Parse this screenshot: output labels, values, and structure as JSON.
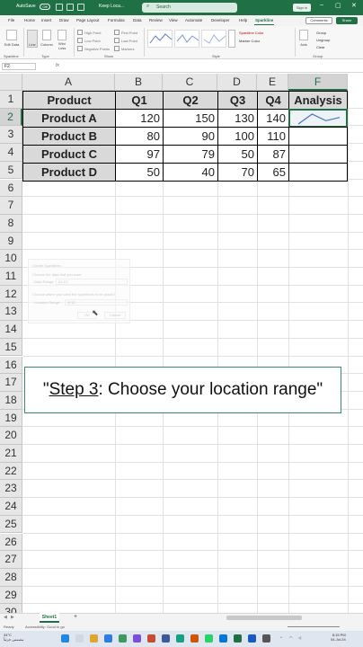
{
  "titlebar": {
    "autosave_label": "AutoSave",
    "autosave_state": "Off",
    "filename": "Keep Loca...",
    "search_placeholder": "Search",
    "signin": "Sign in",
    "minimize": "–",
    "restore": "▢",
    "close": "✕"
  },
  "ribbon_tabs": [
    "File",
    "Home",
    "Insert",
    "Draw",
    "Page Layout",
    "Formulas",
    "Data",
    "Review",
    "View",
    "Automate",
    "Developer",
    "Help",
    "Sparkline"
  ],
  "ribbon_tab_active": "Sparkline",
  "ribbon_buttons": {
    "comments": "Comments",
    "share": "Share"
  },
  "ribbon": {
    "sparkline_group": "Sparkline",
    "edit_data": "Edit Data",
    "type_group": "Type",
    "type_line": "Line",
    "type_column": "Column",
    "type_winloss": "Win/ Loss",
    "show_group": "Show",
    "show_options": [
      "High Point",
      "Low Point",
      "Negative Points",
      "First Point",
      "Last Point",
      "Markers"
    ],
    "style_group": "Style",
    "sparkline_color": "Sparkline Color",
    "marker_color": "Marker Color",
    "axis": "Axis",
    "group_cmd": "Group",
    "ungroup_cmd": "Ungroup",
    "clear_cmd": "Clear",
    "group_group": "Group"
  },
  "formula_bar": {
    "name_box": "F2",
    "fx": "fx",
    "value": ""
  },
  "columns": [
    "A",
    "B",
    "C",
    "D",
    "E",
    "F"
  ],
  "selected_column": "F",
  "rows": [
    "1",
    "2",
    "3",
    "4",
    "5",
    "6",
    "7",
    "8",
    "9",
    "10",
    "11",
    "12",
    "13",
    "14",
    "15",
    "16",
    "17",
    "18",
    "19",
    "20",
    "21",
    "22",
    "23",
    "24",
    "25",
    "26",
    "27",
    "28",
    "29",
    "30"
  ],
  "selected_row": "2",
  "table": {
    "headers": [
      "Product",
      "Q1",
      "Q2",
      "Q3",
      "Q4",
      "Analysis"
    ],
    "rows": [
      {
        "product": "Product A",
        "q1": "120",
        "q2": "150",
        "q3": "130",
        "q4": "140"
      },
      {
        "product": "Product B",
        "q1": "80",
        "q2": "90",
        "q3": "100",
        "q4": "110"
      },
      {
        "product": "Product C",
        "q1": "97",
        "q2": "79",
        "q3": "50",
        "q4": "87"
      },
      {
        "product": "Product D",
        "q1": "50",
        "q2": "40",
        "q3": "70",
        "q4": "65"
      }
    ]
  },
  "sparkline": {
    "values": [
      120,
      150,
      130,
      140
    ],
    "color": "#4472c4"
  },
  "ghost_dialog": {
    "title": "Create Sparklines",
    "prompt_data": "Choose the data that you want",
    "data_range_label": "Data Range:",
    "data_range_value": "B2:E2",
    "prompt_location": "Choose where you want the sparklines to be placed",
    "location_label": "Location Range:",
    "location_value": "$F$2",
    "ok": "OK",
    "cancel": "Cancel"
  },
  "caption": {
    "open_quote": "\"",
    "step": "Step 3",
    "rest": ": Choose your location range\""
  },
  "sheet_tab": "Sheet1",
  "add_sheet": "+",
  "status": {
    "ready": "Ready",
    "accessibility": "Accessibility: Good to go"
  },
  "taskbar": {
    "temp": "34°C",
    "weather": "مشمس جزئياً",
    "time": "8:15 PM",
    "date": "04-Jul-24"
  },
  "colors": {
    "excel_green": "#1f7145",
    "header_fill": "#d9d9d9",
    "caption_border": "#3a8a6e"
  }
}
